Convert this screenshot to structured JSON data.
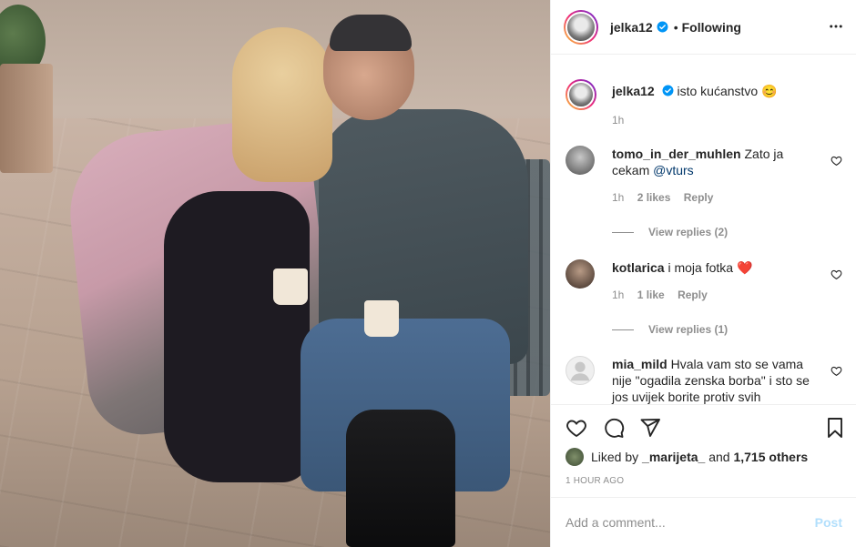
{
  "post": {
    "username": "jelka12",
    "following_label": "Following",
    "dot": "•",
    "caption_text": "isto kućanstvo",
    "caption_emoji": "😊",
    "caption_time": "1h"
  },
  "comments": [
    {
      "user": "tomo_in_der_muhlen",
      "text_before": "Zato ja cekam",
      "mention": "@vturs",
      "time": "1h",
      "likes": "2 likes",
      "reply": "Reply",
      "view_replies": "View replies (2)"
    },
    {
      "user": "kotlarica",
      "text_before": "i moja fotka",
      "emoji": "❤️",
      "time": "1h",
      "likes": "1 like",
      "reply": "Reply",
      "view_replies": "View replies (1)"
    },
    {
      "user": "mia_mild",
      "text_before": "Hvala vam sto se vama nije \"ogadila zenska borba\" i sto se jos uvijek borite protiv svih"
    }
  ],
  "likes": {
    "prefix": "Liked by",
    "user": "_marijeta_",
    "and": "and",
    "others": "1,715 others"
  },
  "time_ago": "1 HOUR AGO",
  "comment_box": {
    "placeholder": "Add a comment...",
    "post_label": "Post"
  },
  "icons": [
    "verified-badge-icon",
    "more-icon",
    "heart-icon",
    "comment-icon",
    "share-icon",
    "bookmark-icon"
  ],
  "colors": {
    "verified": "#0095f6",
    "link": "#00376b",
    "muted": "#8e8e8e",
    "post_disabled": "#b2dffc"
  }
}
